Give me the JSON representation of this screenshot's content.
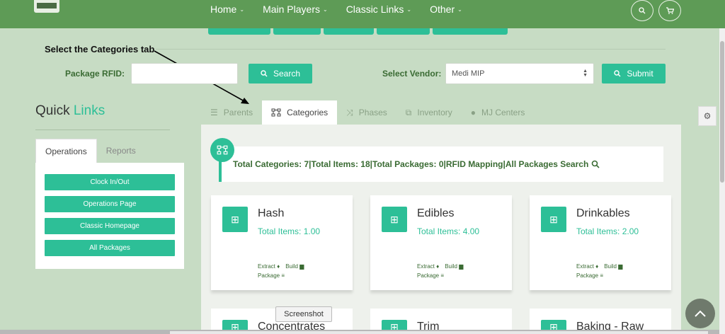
{
  "nav": {
    "items": [
      {
        "label": "Home"
      },
      {
        "label": "Main Players"
      },
      {
        "label": "Classic Links"
      },
      {
        "label": "Other"
      }
    ],
    "chevron": "⌄",
    "search_icon": "search-icon",
    "cart_icon": "cart-icon"
  },
  "annotation": {
    "text": "Select the Categories tab"
  },
  "rfid": {
    "label": "Package RFID:",
    "value": "",
    "search_label": "Search"
  },
  "vendor": {
    "label": "Select Vendor:",
    "selected": "Medi MIP",
    "submit_label": "Submit"
  },
  "quick_links": {
    "title_prefix": "Quick",
    "title_accent": "Links",
    "tabs": [
      "Operations",
      "Reports"
    ],
    "buttons": [
      "Clock In/Out",
      "Operations Page",
      "Classic Homepage",
      "All Packages"
    ]
  },
  "tabs": [
    {
      "label": "Parents",
      "icon": "list-icon"
    },
    {
      "label": "Categories",
      "icon": "sitemap-icon"
    },
    {
      "label": "Phases",
      "icon": "random-icon"
    },
    {
      "label": "Inventory",
      "icon": "cubes-icon"
    },
    {
      "label": "MJ Centers",
      "icon": "user-icon"
    }
  ],
  "summary": {
    "total_categories": "Total Categories: 7",
    "total_items": "Total Items: 18",
    "total_packages": "Total Packages: 0",
    "rfid_mapping": "RFID Mapping",
    "all_packages_search": "All Packages Search",
    "sep": " | "
  },
  "categories": [
    {
      "name": "Hash",
      "total": "Total Items: 1.00",
      "extract": "Extract",
      "build": "Build",
      "package": "Package"
    },
    {
      "name": "Edibles",
      "total": "Total Items: 4.00",
      "extract": "Extract",
      "build": "Build",
      "package": "Package"
    },
    {
      "name": "Drinkables",
      "total": "Total Items: 2.00",
      "extract": "Extract",
      "build": "Build",
      "package": "Package"
    }
  ],
  "categories_row2": [
    {
      "name": "Concentrates"
    },
    {
      "name": "Trim"
    },
    {
      "name": "Baking - Raw"
    }
  ],
  "tooltip": "Screenshot",
  "colors": {
    "accent": "#2dbf97",
    "nav_green": "#5e9b56",
    "label_green": "#3a6b33"
  }
}
